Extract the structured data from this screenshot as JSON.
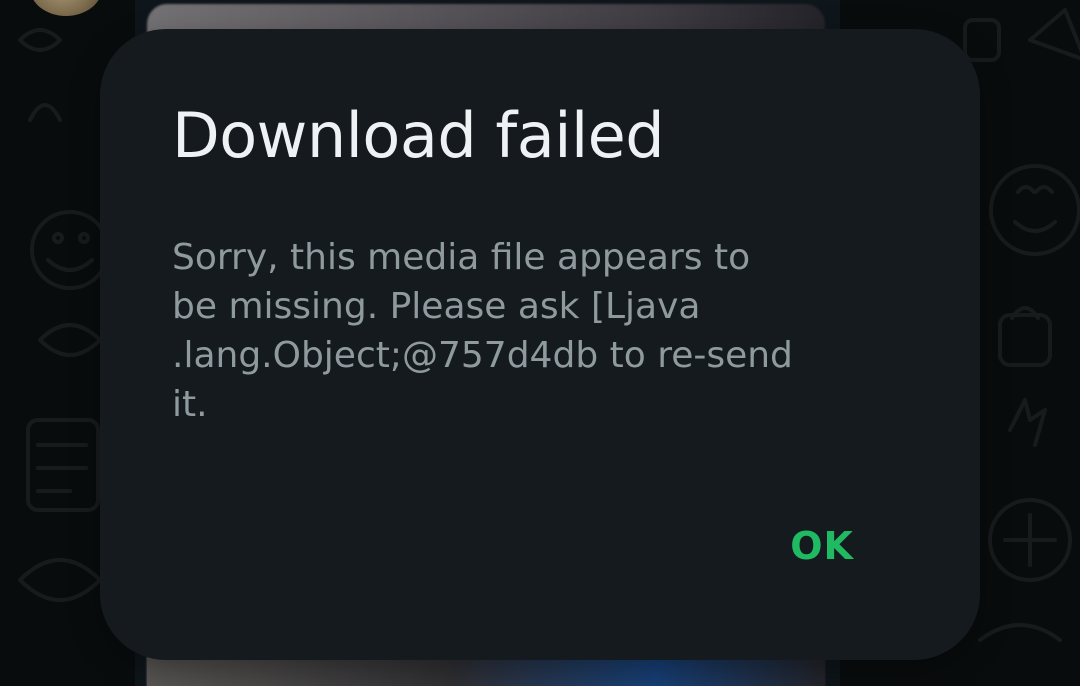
{
  "dialog": {
    "title": "Download failed",
    "message": "Sorry, this media file appears to\nbe missing. Please ask [Ljava\n.lang.Object;@757d4db to re-send\nit.",
    "ok_label": "OK",
    "accent_color": "#1fba62"
  },
  "background": {
    "theme": "dark chat wallpaper"
  }
}
